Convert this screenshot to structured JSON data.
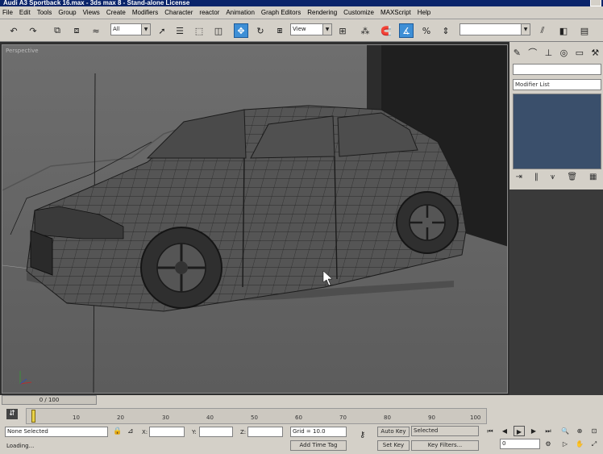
{
  "window": {
    "title": "Audi A3 Sportback 16.max - 3ds max 8 - Stand-alone License"
  },
  "menu": [
    "File",
    "Edit",
    "Tools",
    "Group",
    "Views",
    "Create",
    "Modifiers",
    "Character",
    "reactor",
    "Animation",
    "Graph Editors",
    "Rendering",
    "Customize",
    "MAXScript",
    "Help"
  ],
  "toolbar": {
    "selection_filter": "All",
    "ref_coord": "View"
  },
  "viewport": {
    "label": "Perspective"
  },
  "command_panel": {
    "modifier_list": "Modifier List"
  },
  "timeslider": {
    "label": "0 / 100"
  },
  "timeline": {
    "ticks": [
      "10",
      "20",
      "30",
      "40",
      "50",
      "60",
      "70",
      "80",
      "90",
      "100"
    ]
  },
  "status": {
    "selection": "None Selected",
    "prompt": "Loading...",
    "x_label": "X:",
    "y_label": "Y:",
    "z_label": "Z:",
    "grid": "Grid = 10.0",
    "add_time_tag": "Add Time Tag",
    "auto_key": "Auto Key",
    "auto_key_mode": "Selected",
    "set_key": "Set Key",
    "key_filters": "Key Filters...",
    "frame": "0"
  }
}
